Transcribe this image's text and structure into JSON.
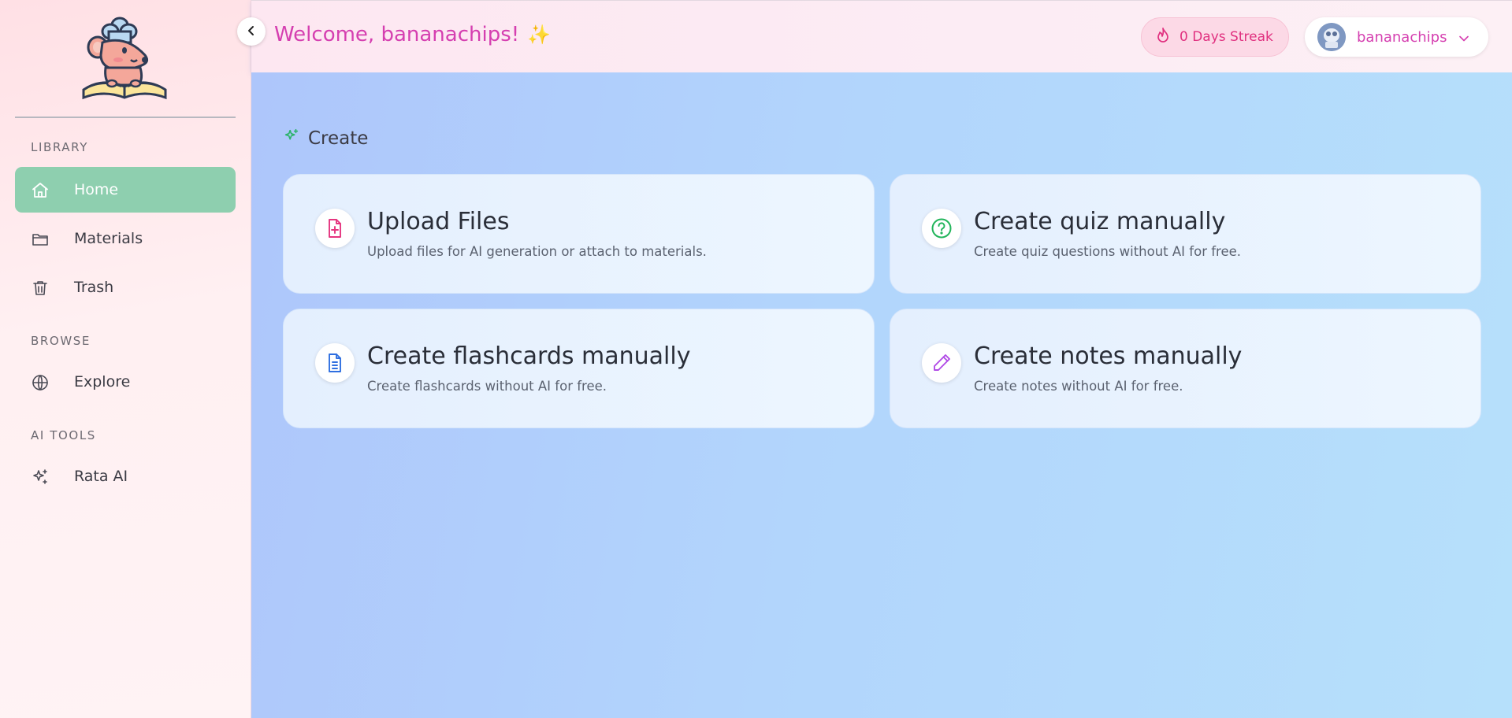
{
  "header": {
    "welcome_text": "Welcome, bananachips!",
    "sparkle_emoji": "✨",
    "streak_label": "0 Days Streak",
    "username": "bananachips"
  },
  "sidebar": {
    "sections": [
      {
        "label": "LIBRARY",
        "items": [
          {
            "label": "Home",
            "icon": "home-icon",
            "active": true
          },
          {
            "label": "Materials",
            "icon": "folder-icon",
            "active": false
          },
          {
            "label": "Trash",
            "icon": "trash-icon",
            "active": false
          }
        ]
      },
      {
        "label": "BROWSE",
        "items": [
          {
            "label": "Explore",
            "icon": "globe-icon",
            "active": false
          }
        ]
      },
      {
        "label": "AI TOOLS",
        "items": [
          {
            "label": "Rata AI",
            "icon": "sparkles-icon",
            "active": false
          }
        ]
      }
    ]
  },
  "main": {
    "section_title": "Create",
    "cards": [
      {
        "title": "Upload Files",
        "description": "Upload files for AI generation or attach to materials.",
        "icon": "file-plus-icon",
        "icon_color": "#e5347f"
      },
      {
        "title": "Create quiz manually",
        "description": "Create quiz questions without AI for free.",
        "icon": "question-circle-icon",
        "icon_color": "#22b55b"
      },
      {
        "title": "Create flashcards manually",
        "description": "Create flashcards without AI for free.",
        "icon": "file-text-icon",
        "icon_color": "#2f6fe0"
      },
      {
        "title": "Create notes manually",
        "description": "Create notes without AI for free.",
        "icon": "pencil-icon",
        "icon_color": "#b14be6"
      }
    ]
  },
  "colors": {
    "accent_pink": "#d53fb0",
    "active_nav": "#8ecfaf",
    "streak_text": "#e0307f"
  }
}
